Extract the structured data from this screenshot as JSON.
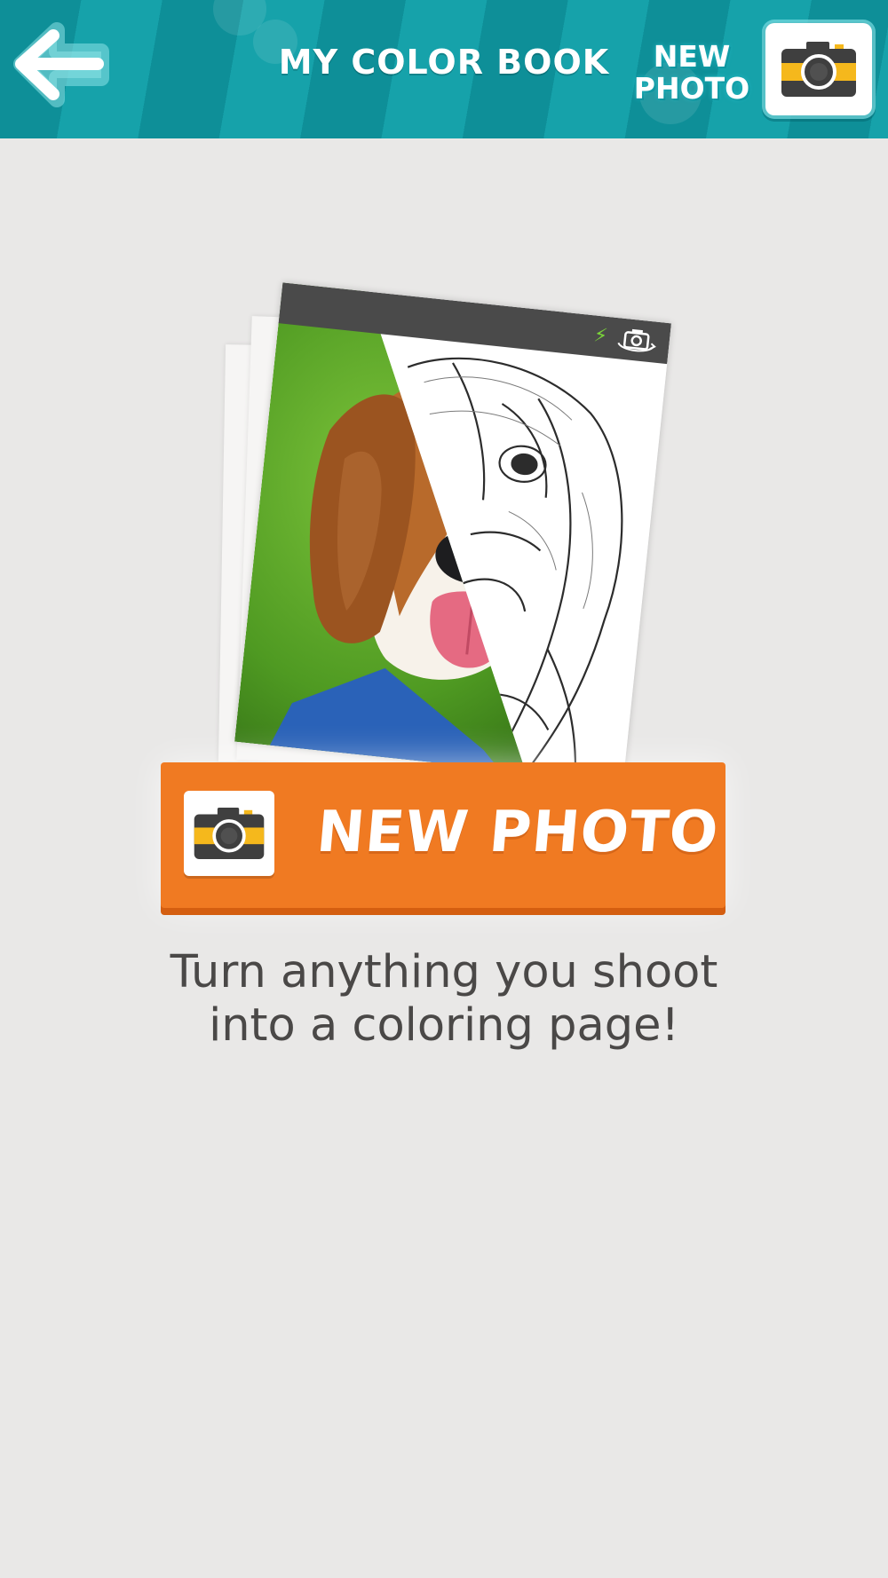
{
  "header": {
    "title": "My Color Book",
    "new_photo_line1": "NEW",
    "new_photo_line2": "PHOTO",
    "back_icon": "back-arrow-icon",
    "camera_icon": "camera-icon"
  },
  "main": {
    "cta_label": "NEW PHOTO",
    "cta_icon": "camera-icon",
    "tagline_line1": "Turn anything you shoot",
    "tagline_line2": "into a coloring page!",
    "illustration": {
      "topbar_icons": [
        "bolt-icon",
        "switch-camera-icon"
      ]
    }
  },
  "colors": {
    "header_teal": "#0e8f98",
    "cta_orange": "#f07a22",
    "camera_yellow": "#f5b81c",
    "background": "#e9e8e7"
  }
}
